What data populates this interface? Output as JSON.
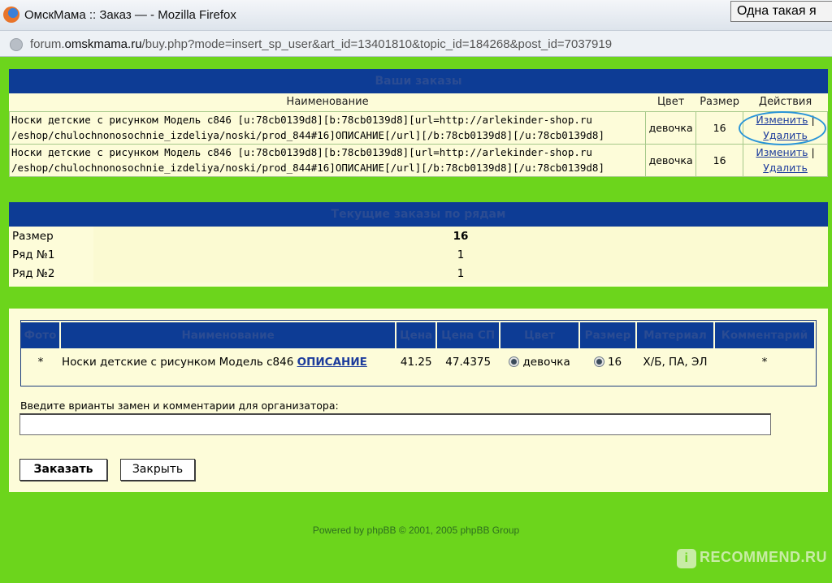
{
  "window": {
    "title": "ОмскМама :: Заказ — - Mozilla Firefox",
    "tooltip": "Одна такая я",
    "url_prefix": "forum.",
    "url_domain": "omskmama.ru",
    "url_rest": "/buy.php?mode=insert_sp_user&art_id=13401810&topic_id=184268&post_id=7037919"
  },
  "orders": {
    "header": "Ваши заказы",
    "columns": [
      "Наименование",
      "Цвет",
      "Размер",
      "Действия"
    ],
    "rows": [
      {
        "name": "Носки детские с рисунком Модель с846 [u:78cb0139d8][b:78cb0139d8][url=http://arlekinder-shop.ru /eshop/chulochnonosochnie_izdeliya/noski/prod_844#16]ОПИСАНИЕ[/url][/b:78cb0139d8][/u:78cb0139d8]",
        "color": "девочка",
        "size": "16",
        "edit": "Изменить",
        "delete": "Удалить"
      },
      {
        "name": "Носки детские с рисунком Модель с846 [u:78cb0139d8][b:78cb0139d8][url=http://arlekinder-shop.ru /eshop/chulochnonosochnie_izdeliya/noski/prod_844#16]ОПИСАНИЕ[/url][/b:78cb0139d8][/u:78cb0139d8]",
        "color": "девочка",
        "size": "16",
        "edit": "Изменить",
        "delete": "Удалить"
      }
    ]
  },
  "rows_table": {
    "header": "Текущие заказы по рядам",
    "rows": [
      {
        "label": "Размер",
        "value": "16"
      },
      {
        "label": "Ряд №1",
        "value": "1"
      },
      {
        "label": "Ряд №2",
        "value": "1"
      }
    ]
  },
  "product": {
    "columns": [
      "Фото",
      "Наименование",
      "Цена",
      "Цена СП",
      "Цвет",
      "Размер",
      "Материал",
      "Комментарий"
    ],
    "photo": "*",
    "name": "Носки детские с рисунком Модель с846",
    "link": "ОПИСАНИЕ",
    "price": "41.25",
    "price_sp": "47.4375",
    "color": "девочка",
    "size": "16",
    "material": "Х/Б, ПА, ЭЛ",
    "comment": "*"
  },
  "form": {
    "comment_label": "Введите врианты замен и комментарии для организатора:",
    "comment_value": "",
    "order_button": "Заказать",
    "close_button": "Закрыть"
  },
  "footer": "Powered by phpBB © 2001, 2005 phpBB Group",
  "watermark": "RECOMMEND.RU"
}
